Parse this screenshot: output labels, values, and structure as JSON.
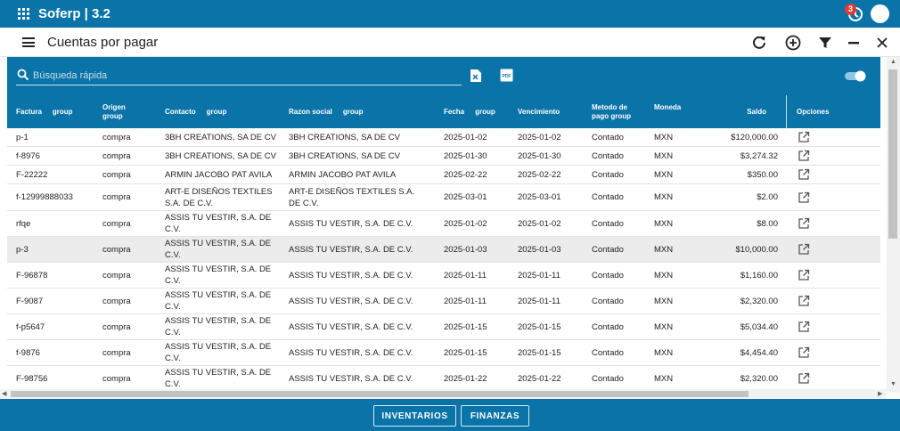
{
  "app": {
    "title": "Soferp | 3.2",
    "notification_count": "3"
  },
  "page": {
    "title": "Cuentas por pagar"
  },
  "search": {
    "placeholder": "Búsqueda rápida"
  },
  "export": {
    "pdf_label": "PDF"
  },
  "columns": {
    "factura": "Factura",
    "origen": "Origen group",
    "contacto": "Contacto",
    "razon": "Razon social",
    "fecha": "Fecha",
    "vencimiento": "Vencimiento",
    "metodo": "Metodo de pago group",
    "moneda": "Moneda",
    "saldo": "Saldo",
    "opciones": "Opciones",
    "group": "group"
  },
  "rows": [
    {
      "factura": "p-1",
      "origen": "compra",
      "contacto": "3BH CREATIONS, SA DE CV",
      "razon": "3BH CREATIONS, SA DE CV",
      "fecha": "2025-01-02",
      "vencimiento": "2025-01-02",
      "metodo": "Contado",
      "moneda": "MXN",
      "saldo": "$120,000.00"
    },
    {
      "factura": "f-8976",
      "origen": "compra",
      "contacto": "3BH CREATIONS, SA DE CV",
      "razon": "3BH CREATIONS, SA DE CV",
      "fecha": "2025-01-30",
      "vencimiento": "2025-01-30",
      "metodo": "Contado",
      "moneda": "MXN",
      "saldo": "$3,274.32"
    },
    {
      "factura": "F-22222",
      "origen": "compra",
      "contacto": "ARMIN JACOBO PAT AVILA",
      "razon": "ARMIN JACOBO PAT AVILA",
      "fecha": "2025-02-22",
      "vencimiento": "2025-02-22",
      "metodo": "Contado",
      "moneda": "MXN",
      "saldo": "$350.00"
    },
    {
      "factura": "f-12999888033",
      "origen": "compra",
      "contacto": "ART-E DISEÑOS TEXTILES S.A. DE C.V.",
      "razon": "ART-E DISEÑOS TEXTILES S.A. DE C.V.",
      "fecha": "2025-03-01",
      "vencimiento": "2025-03-01",
      "metodo": "Contado",
      "moneda": "MXN",
      "saldo": "$2.00"
    },
    {
      "factura": "rfqe",
      "origen": "compra",
      "contacto": "ASSIS TU VESTIR, S.A. DE C.V.",
      "razon": "ASSIS TU VESTIR, S.A. DE C.V.",
      "fecha": "2025-01-02",
      "vencimiento": "2025-01-02",
      "metodo": "Contado",
      "moneda": "MXN",
      "saldo": "$8.00"
    },
    {
      "factura": "p-3",
      "origen": "compra",
      "contacto": "ASSIS TU VESTIR, S.A. DE C.V.",
      "razon": "ASSIS TU VESTIR, S.A. DE C.V.",
      "fecha": "2025-01-03",
      "vencimiento": "2025-01-03",
      "metodo": "Contado",
      "moneda": "MXN",
      "saldo": "$10,000.00"
    },
    {
      "factura": "F-96878",
      "origen": "compra",
      "contacto": "ASSIS TU VESTIR, S.A. DE C.V.",
      "razon": "ASSIS TU VESTIR, S.A. DE C.V.",
      "fecha": "2025-01-11",
      "vencimiento": "2025-01-11",
      "metodo": "Contado",
      "moneda": "MXN",
      "saldo": "$1,160.00"
    },
    {
      "factura": "F-9087",
      "origen": "compra",
      "contacto": "ASSIS TU VESTIR, S.A. DE C.V.",
      "razon": "ASSIS TU VESTIR, S.A. DE C.V.",
      "fecha": "2025-01-11",
      "vencimiento": "2025-01-11",
      "metodo": "Contado",
      "moneda": "MXN",
      "saldo": "$2,320.00"
    },
    {
      "factura": "f-p5647",
      "origen": "compra",
      "contacto": "ASSIS TU VESTIR, S.A. DE C.V.",
      "razon": "ASSIS TU VESTIR, S.A. DE C.V.",
      "fecha": "2025-01-15",
      "vencimiento": "2025-01-15",
      "metodo": "Contado",
      "moneda": "MXN",
      "saldo": "$5,034.40"
    },
    {
      "factura": "f-9876",
      "origen": "compra",
      "contacto": "ASSIS TU VESTIR, S.A. DE C.V.",
      "razon": "ASSIS TU VESTIR, S.A. DE C.V.",
      "fecha": "2025-01-15",
      "vencimiento": "2025-01-15",
      "metodo": "Contado",
      "moneda": "MXN",
      "saldo": "$4,454.40"
    },
    {
      "factura": "F-98756",
      "origen": "compra",
      "contacto": "ASSIS TU VESTIR, S.A. DE C.V.",
      "razon": "ASSIS TU VESTIR, S.A. DE C.V.",
      "fecha": "2025-01-22",
      "vencimiento": "2025-01-22",
      "metodo": "Contado",
      "moneda": "MXN",
      "saldo": "$2,320.00"
    }
  ],
  "footer": {
    "inventarios": "INVENTARIOS",
    "finanzas": "FINANZAS"
  },
  "colors": {
    "primary": "#0a73a8",
    "selected_row": "#ececec",
    "badge": "#e53935"
  },
  "icons": {
    "apps": "apps-grid-icon",
    "refresh": "refresh-icon",
    "add": "add-circle-icon",
    "filter": "filter-icon",
    "minimize": "minimize-icon",
    "close": "close-icon",
    "search": "search-icon",
    "excel": "excel-export-icon",
    "pdf": "pdf-export-icon",
    "open": "open-in-new-icon"
  },
  "state": {
    "toggle_on": true,
    "selected_row": "p-3"
  }
}
